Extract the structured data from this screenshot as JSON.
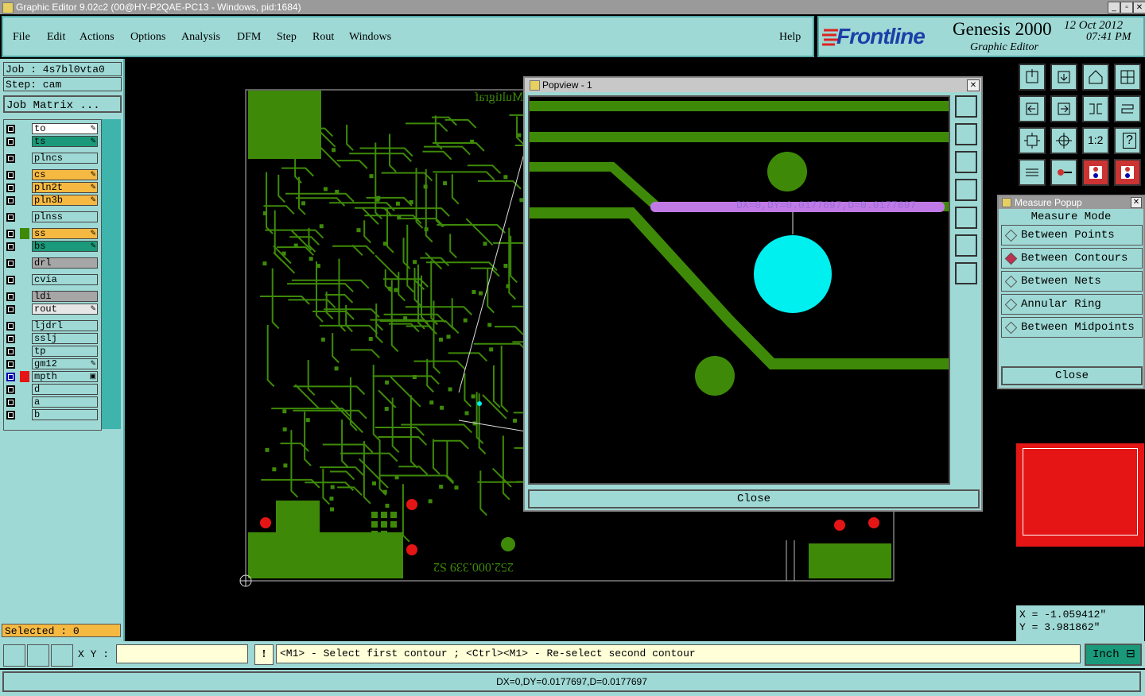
{
  "window": {
    "title": "Graphic Editor 9.02c2 (00@HY-P2QAE-PC13 - Windows, pid:1684)"
  },
  "menu": [
    "File",
    "Edit",
    "Actions",
    "Options",
    "Analysis",
    "DFM",
    "Step",
    "Rout",
    "Windows"
  ],
  "help_label": "Help",
  "brand": {
    "logo": "Frontline",
    "product": "Genesis 2000",
    "subtitle": "Graphic Editor",
    "date": "12 Oct 2012",
    "time": "07:41 PM"
  },
  "job": {
    "job_label": "Job : 4s7bl0vta0",
    "step_label": "Step: cam",
    "matrix_button": "Job Matrix ..."
  },
  "layers": [
    {
      "name": "to",
      "color": "#ffffff",
      "mark": "✎"
    },
    {
      "name": "ts",
      "color": "#1a9a7a",
      "mark": "✎"
    },
    {
      "name": "plncs",
      "color": "#9ed9d5",
      "mark": ""
    },
    {
      "name": "cs",
      "color": "#f5b942",
      "mark": "✎"
    },
    {
      "name": "pln2t",
      "color": "#f5b942",
      "mark": "✎"
    },
    {
      "name": "pln3b",
      "color": "#f5b942",
      "mark": "✎"
    },
    {
      "name": "plnss",
      "color": "#9ed9d5",
      "mark": ""
    },
    {
      "name": "ss",
      "color": "#f5b942",
      "mark": "✎"
    },
    {
      "name": "bs",
      "color": "#1a9a7a",
      "mark": "✎"
    },
    {
      "name": "drl",
      "color": "#a6a6a6",
      "mark": ""
    },
    {
      "name": "cvia",
      "color": "#9ed9d5",
      "mark": ""
    },
    {
      "name": "ldi",
      "color": "#a6a6a6",
      "mark": ""
    },
    {
      "name": "rout",
      "color": "#e6e6e6",
      "mark": "✎"
    },
    {
      "name": "ljdrl",
      "color": "#9ed9d5",
      "mark": ""
    },
    {
      "name": "sslj",
      "color": "#9ed9d5",
      "mark": ""
    },
    {
      "name": "tp",
      "color": "#9ed9d5",
      "mark": ""
    },
    {
      "name": "gm12",
      "color": "#9ed9d5",
      "mark": "✎"
    },
    {
      "name": "mpth",
      "color": "#9ed9d5",
      "mark": "▣"
    },
    {
      "name": "d",
      "color": "#9ed9d5",
      "mark": ""
    },
    {
      "name": "a",
      "color": "#9ed9d5",
      "mark": ""
    },
    {
      "name": "b",
      "color": "#9ed9d5",
      "mark": ""
    }
  ],
  "selected_label": "Selected : 0",
  "board_text": {
    "top": "Multigraf",
    "bottom": "252.000.339 S2"
  },
  "popview": {
    "title": "Popview - 1",
    "measure_readout": "DX=0,DY=0.0177697,D=0.0177697",
    "close_label": "Close"
  },
  "measure_popup": {
    "title": "Measure Popup",
    "mode_label": "Measure Mode",
    "options": [
      {
        "label": "Between Points",
        "selected": false
      },
      {
        "label": "Between Contours",
        "selected": true
      },
      {
        "label": "Between Nets",
        "selected": false
      },
      {
        "label": "Annular Ring",
        "selected": false
      },
      {
        "label": "Between Midpoints",
        "selected": false
      }
    ],
    "close_label": "Close"
  },
  "toolbox": {
    "ratio_label": "1:2",
    "help_glyph": "?"
  },
  "coords": {
    "x": "X = -1.059412\"",
    "y": "Y = 3.981862\""
  },
  "cmd": {
    "xy_label": "X Y :",
    "xy_value": "",
    "hint": "<M1> - Select first contour ; <Ctrl><M1> - Re-select second contour",
    "units": "Inch"
  },
  "status": "DX=0,DY=0.0177697,D=0.0177697",
  "colors": {
    "panel": "#9ed9d5",
    "trace": "#3e8a08",
    "pad_red": "#e51515",
    "highlight": "#c07ae6",
    "measure_pad": "#00f0f0"
  }
}
